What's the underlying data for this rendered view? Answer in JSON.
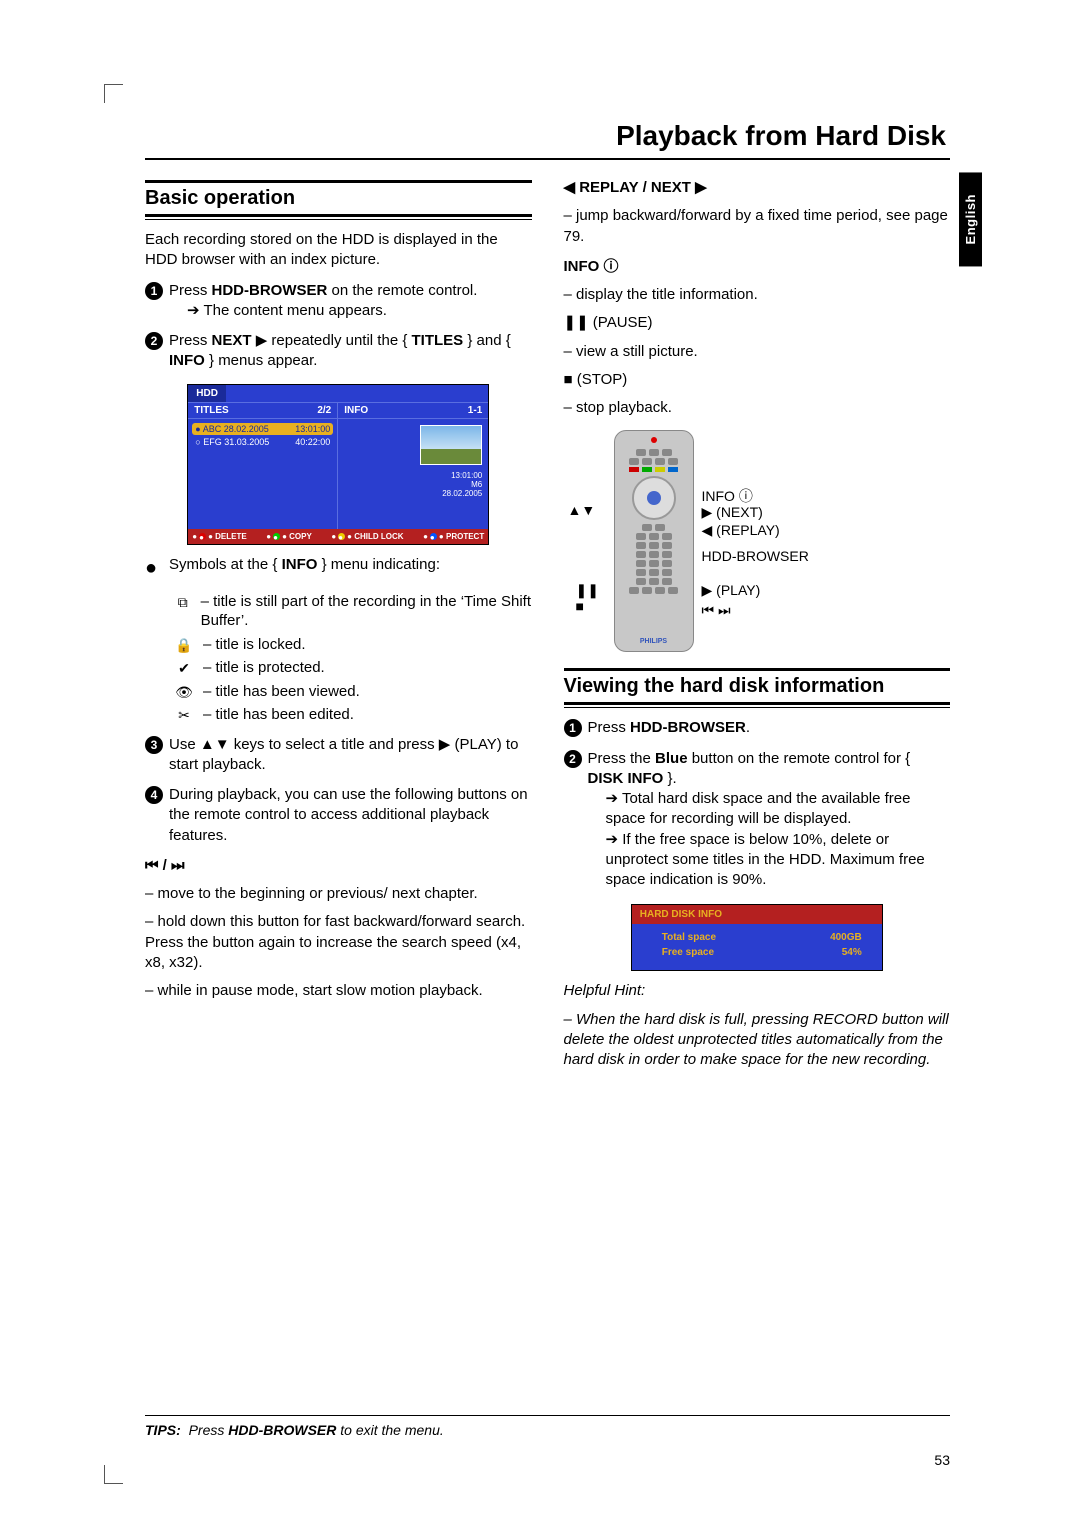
{
  "page_title": "Playback from Hard Disk",
  "language_tab": "English",
  "section_basic": "Basic operation",
  "intro": "Each recording stored on the HDD is displayed in the HDD browser with an index picture.",
  "steps": {
    "s1a": "Press ",
    "s1b": "HDD-BROWSER",
    "s1c": " on the remote control.",
    "s1_res": "The content menu appears.",
    "s2a": "Press ",
    "s2b": "NEXT",
    "s2c": " ▶ repeatedly until the { ",
    "s2d": "TITLES",
    "s2e": " } and { ",
    "s2f": "INFO",
    "s2g": " } menus appear.",
    "bullet_a": "Symbols at the { ",
    "bullet_b": "INFO",
    "bullet_c": " } menu indicating:",
    "sym1": "– title is still part of the recording in the ‘Time Shift Buffer’.",
    "sym2": "– title is locked.",
    "sym3": "– title is protected.",
    "sym4": "– title has been viewed.",
    "sym5": "– title has been edited.",
    "s3": "Use ▲▼ keys to select a title and press ▶ (PLAY) to start playback.",
    "s4": "During playback, you can use the following buttons on the remote control to access additional playback features."
  },
  "browser": {
    "tab": "HDD",
    "titles_label": "TITLES",
    "titles_count": "2/2",
    "info_label": "INFO",
    "info_count": "1-1",
    "row1_left": "ABC 28.02.2005",
    "row1_right": "13:01:00",
    "row2_left": "EFG 31.03.2005",
    "row2_right": "40:22:00",
    "info_time": "13:01:00",
    "info_m6": "M6",
    "info_date": "28.02.2005",
    "footer_delete": "DELETE",
    "footer_copy": "COPY",
    "footer_childlock": "CHILD LOCK",
    "footer_protect": "PROTECT"
  },
  "controls": {
    "skip_heading": "⏮ / ⏭",
    "skip1": "– move to the beginning or previous/ next chapter.",
    "skip2": "– hold down this button for fast backward/forward search.  Press the button again to increase the search speed (x4, x8, x32).",
    "skip3": "– while in pause mode, start slow motion playback.",
    "replay_heading": "◀ REPLAY / NEXT ▶",
    "replay1": "– jump backward/forward by a fixed time period, see page 79.",
    "info_heading": "INFO ⓘ",
    "info1": "– display the title information.",
    "pause_heading": "❚❚ (PAUSE)",
    "pause1": "– view a still picture.",
    "stop_heading": "■ (STOP)",
    "stop1": "– stop playback."
  },
  "remote_labels": {
    "updown": "▲▼",
    "pause": "❚❚",
    "stop": "■",
    "info": "INFO ⓘ",
    "next": "▶ (NEXT)",
    "replay": "◀ (REPLAY)",
    "hdd": "HDD-BROWSER",
    "play": "▶ (PLAY)",
    "skip": "⏮ ⏭",
    "brand": "PHILIPS"
  },
  "section_view": "Viewing the hard disk information",
  "view_steps": {
    "v1a": "Press ",
    "v1b": "HDD-BROWSER",
    "v1c": ".",
    "v2a": "Press the ",
    "v2b": "Blue",
    "v2c": " button on the remote control for { ",
    "v2d": "DISK INFO",
    "v2e": " }.",
    "v_res1": "Total hard disk space and the available free space for recording will be displayed.",
    "v_res2": "If the free space is below 10%, delete or unprotect some titles in the HDD. Maximum free space indication is 90%."
  },
  "disk_info": {
    "header": "HARD DISK INFO",
    "total_label": "Total space",
    "total_value": "400GB",
    "free_label": "Free space",
    "free_value": "54%"
  },
  "hint_label": "Helpful Hint:",
  "hint_text": "– When the hard disk is full, pressing RECORD button will delete the oldest unprotected titles automatically from the hard disk in order to make space for the new recording.",
  "footer_tip_a": "TIPS:",
  "footer_tip_b": "Press ",
  "footer_tip_c": "HDD-BROWSER",
  "footer_tip_d": " to exit the menu.",
  "page_number": "53"
}
